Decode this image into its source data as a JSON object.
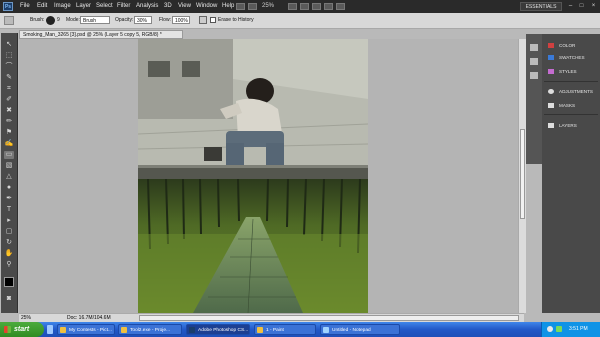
{
  "app": {
    "logo": "Ps",
    "workspace": "ESSENTIALS"
  },
  "menu": [
    "File",
    "Edit",
    "Image",
    "Layer",
    "Select",
    "Filter",
    "Analysis",
    "3D",
    "View",
    "Window",
    "Help"
  ],
  "menu_zoom": "25%",
  "window_controls": [
    "–",
    "□",
    "×"
  ],
  "options": {
    "brush_label": "Brush:",
    "brush_size": "9",
    "mode_label": "Mode:",
    "mode_value": "Brush",
    "opacity_label": "Opacity:",
    "opacity_value": "30%",
    "flow_label": "Flow:",
    "flow_value": "100%",
    "erase_history_label": "Erase to History"
  },
  "document": {
    "tab_title": "Smoking_Man_3265 [3].psd @ 25% (Layer 5 copy 5, RGB/8) *",
    "zoom": "25%",
    "doc_info": "Doc: 16.7M/104.6M"
  },
  "panels": [
    {
      "label": "COLOR",
      "icon": "color-icon",
      "color": "#d04040"
    },
    {
      "label": "SWATCHES",
      "icon": "swatches-icon",
      "color": "#3a7ad8"
    },
    {
      "label": "STYLES",
      "icon": "styles-icon",
      "color": "#c46cd0"
    },
    {
      "label": "ADJUSTMENTS",
      "icon": "adjustments-icon",
      "color": "#dddddd"
    },
    {
      "label": "MASKS",
      "icon": "masks-icon",
      "color": "#dddddd"
    },
    {
      "label": "LAYERS",
      "icon": "layers-icon",
      "color": "#dddddd"
    }
  ],
  "taskbar": {
    "start_label": "start",
    "tasks": [
      "My Contests - Pict...",
      "Tool2.exe - Proje...",
      "Adobe Photoshop CS...",
      "1 - Paint",
      "Untitled - Notepad"
    ],
    "active_task_index": 2,
    "time": "3:51 PM"
  }
}
